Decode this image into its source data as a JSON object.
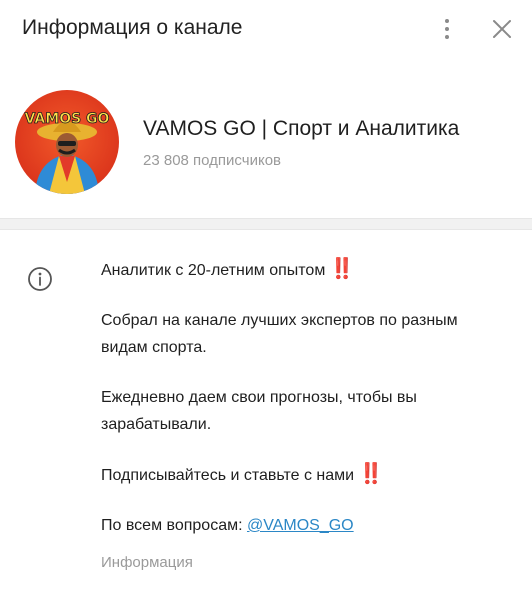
{
  "header": {
    "title": "Информация о канале",
    "menu_icon": "more-vertical-icon",
    "close_icon": "close-icon"
  },
  "channel": {
    "name": "VAMOS GO | Спорт и Аналитика",
    "subscribers": "23 808 подписчиков",
    "avatar_text": "VAMOS GO"
  },
  "description": {
    "line1": "Аналитик с 20-летним опытом",
    "line1_emoji": "‼️",
    "para2": "Собрал на канале лучших экспертов по разным видам спорта.",
    "para3": "Ежедневно даем свои прогнозы, чтобы вы зарабатывали.",
    "para4": "Подписывайтесь и ставьте с нами",
    "para4_emoji": "‼️",
    "contact_prefix": "По всем вопросам: ",
    "contact_link": "@VAMOS_GO",
    "label": "Информация"
  },
  "colors": {
    "link": "#2b87c6",
    "accent_red": "#e02b2b",
    "muted": "#9a9a9a"
  }
}
